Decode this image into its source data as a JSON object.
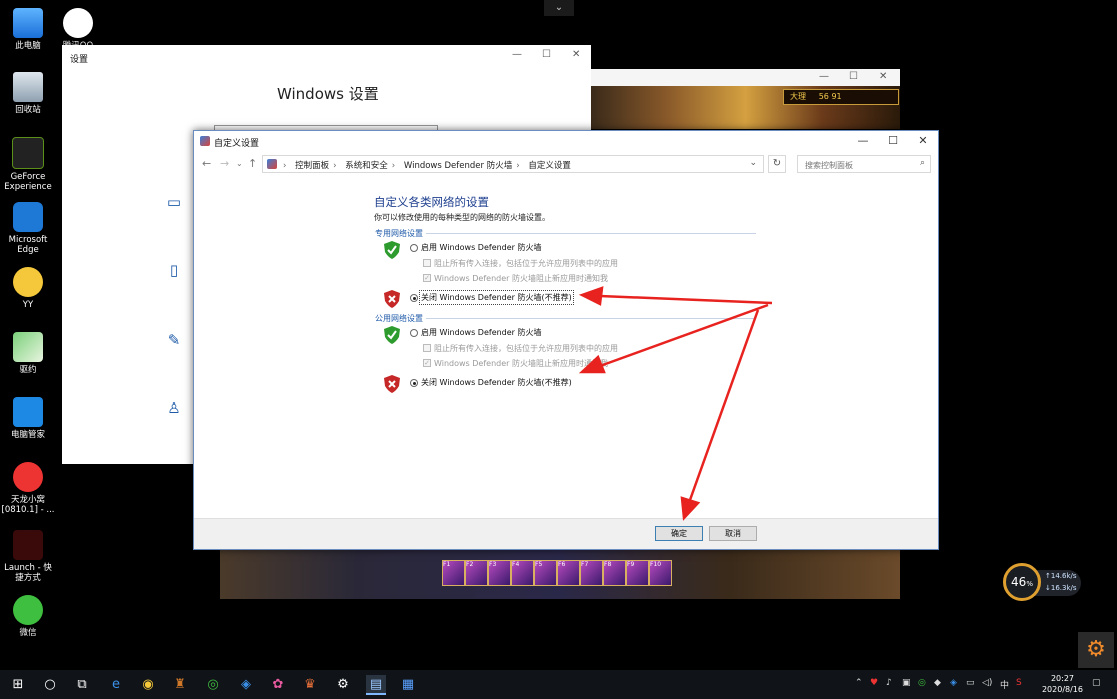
{
  "desktop": {
    "icons": [
      {
        "label": "此电脑"
      },
      {
        "label": "回收站"
      },
      {
        "label": "GeForce Experience"
      },
      {
        "label": "Microsoft Edge"
      },
      {
        "label": "YY"
      },
      {
        "label": "驱约"
      },
      {
        "label": "电脑管家"
      },
      {
        "label": "天龙小窝 [0810.1] - ..."
      },
      {
        "label": "Launch - 快捷方式"
      },
      {
        "label": "微信"
      },
      {
        "label": "腾讯QQ"
      }
    ]
  },
  "settings_window": {
    "title": "设置",
    "heading": "Windows 设置"
  },
  "game_window": {
    "location": "大理",
    "coords": "56  91"
  },
  "skillbar": {
    "keys": [
      "F1",
      "F2",
      "F3",
      "F4",
      "F5",
      "F6",
      "F7",
      "F8",
      "F9",
      "F10"
    ]
  },
  "control_panel": {
    "title": "自定义设置",
    "breadcrumb": [
      "控制面板",
      "系统和安全",
      "Windows Defender 防火墙",
      "自定义设置"
    ],
    "search_placeholder": "搜索控制面板",
    "heading": "自定义各类网络的设置",
    "description": "你可以修改使用的每种类型的网络的防火墙设置。",
    "private": {
      "section_label": "专用网络设置",
      "enable_label": "启用 Windows Defender 防火墙",
      "block_all_label": "阻止所有传入连接，包括位于允许应用列表中的应用",
      "notify_label": "Windows Defender 防火墙阻止新应用时通知我",
      "disable_label": "关闭 Windows Defender 防火墙(不推荐)"
    },
    "public": {
      "section_label": "公用网络设置",
      "enable_label": "启用 Windows Defender 防火墙",
      "block_all_label": "阻止所有传入连接，包括位于允许应用列表中的应用",
      "notify_label": "Windows Defender 防火墙阻止新应用时通知我",
      "disable_label": "关闭 Windows Defender 防火墙(不推荐)"
    },
    "ok_label": "确定",
    "cancel_label": "取消"
  },
  "net_widget": {
    "percent": "46",
    "percent_unit": "%",
    "up": "14.6k/s",
    "down": "16.3k/s"
  },
  "taskbar": {
    "time": "20:27",
    "date": "2020/8/16",
    "ime": "中"
  },
  "colors": {
    "accent": "#1e3f8f",
    "arrow": "#e8231f",
    "shield_ok": "#2e9b2e",
    "shield_off": "#c62828"
  }
}
